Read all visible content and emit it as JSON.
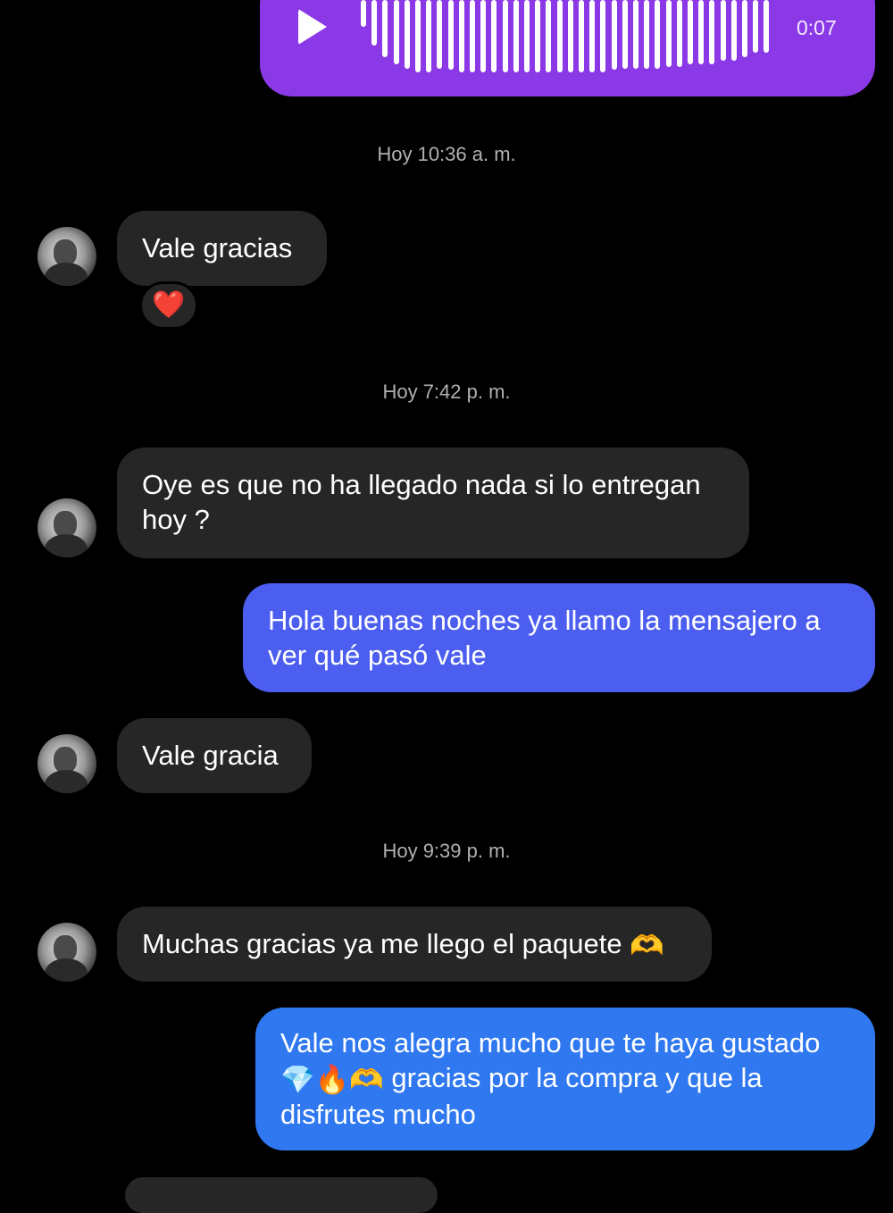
{
  "voice_message": {
    "duration": "0:07",
    "waveform_levels": [
      0.35,
      0.6,
      0.75,
      0.85,
      0.9,
      0.95,
      0.95,
      0.9,
      0.92,
      0.95,
      0.95,
      0.95,
      0.95,
      0.95,
      0.95,
      0.95,
      0.95,
      0.95,
      0.95,
      0.95,
      0.95,
      0.95,
      0.95,
      0.92,
      0.9,
      0.9,
      0.9,
      0.9,
      0.88,
      0.88,
      0.85,
      0.85,
      0.85,
      0.8,
      0.8,
      0.75,
      0.7,
      0.7
    ],
    "color": "#8b38e6"
  },
  "timestamps": [
    "Hoy 10:36 a. m.",
    "Hoy 7:42 p. m.",
    "Hoy 9:39 p. m."
  ],
  "messages": [
    {
      "text": "Vale gracias",
      "reaction": "❤️"
    },
    {
      "text": "Oye es que no ha llegado nada si lo entregan hoy ?"
    },
    {
      "text": "Hola buenas noches ya llamo la mensajero a ver qué pasó vale",
      "color": "#4c5ef0"
    },
    {
      "text": "Vale gracia"
    },
    {
      "text": "Muchas gracias ya me llego el paquete",
      "emoji": "🫶"
    },
    {
      "text_line1": "Vale nos alegra mucho que te haya gustado",
      "emojis": "💎🔥🫶",
      "text_line2": " gracias por la compra y que la",
      "text_line3": "disfrutes mucho",
      "color": "#2f78f0"
    }
  ],
  "colors": {
    "incoming_bubble": "#262626",
    "background": "#000000"
  }
}
